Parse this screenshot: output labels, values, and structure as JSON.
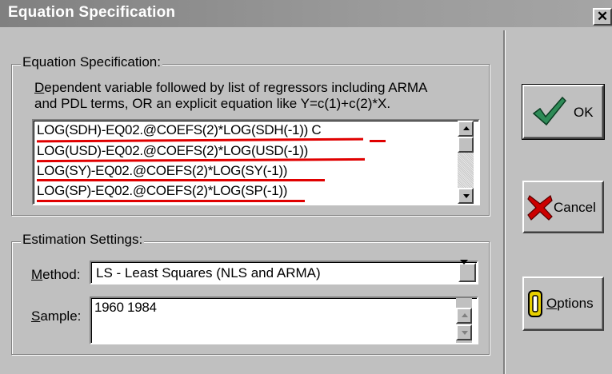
{
  "window": {
    "title": "Equation Specification",
    "close_glyph": "✕"
  },
  "equation_group": {
    "label": "Equation Specification:",
    "hint_line1": "Dependent variable followed by list of regressors including ARMA",
    "hint_line2": "and PDL terms, OR an explicit equation like Y=c(1)+c(2)*X.",
    "lines": [
      "LOG(SDH)-EQ02.@COEFS(2)*LOG(SDH(-1)) C",
      "LOG(USD)-EQ02.@COEFS(2)*LOG(USD(-1))",
      "LOG(SY)-EQ02.@COEFS(2)*LOG(SY(-1))",
      "LOG(SP)-EQ02.@COEFS(2)*LOG(SP(-1))"
    ],
    "annotation_color": "#e00000"
  },
  "estimation_group": {
    "label": "Estimation Settings:",
    "method_label_u": "M",
    "method_label_rest": "ethod:",
    "method_value": "LS  -  Least Squares (NLS and ARMA)",
    "sample_label_u": "S",
    "sample_label_rest": "ample:",
    "sample_value": "1960 1984"
  },
  "buttons": {
    "ok_label": "OK",
    "cancel_label": "Cancel",
    "options_label_u": "O",
    "options_label_rest": "ptions"
  },
  "colors": {
    "ok_check": "#2e8b57",
    "cancel_x": "#cc0000",
    "options_icon": "#e8d000"
  },
  "icons": {
    "ok": "checkmark-icon",
    "cancel": "red-x-icon",
    "options": "options-icon",
    "close": "close-icon"
  }
}
